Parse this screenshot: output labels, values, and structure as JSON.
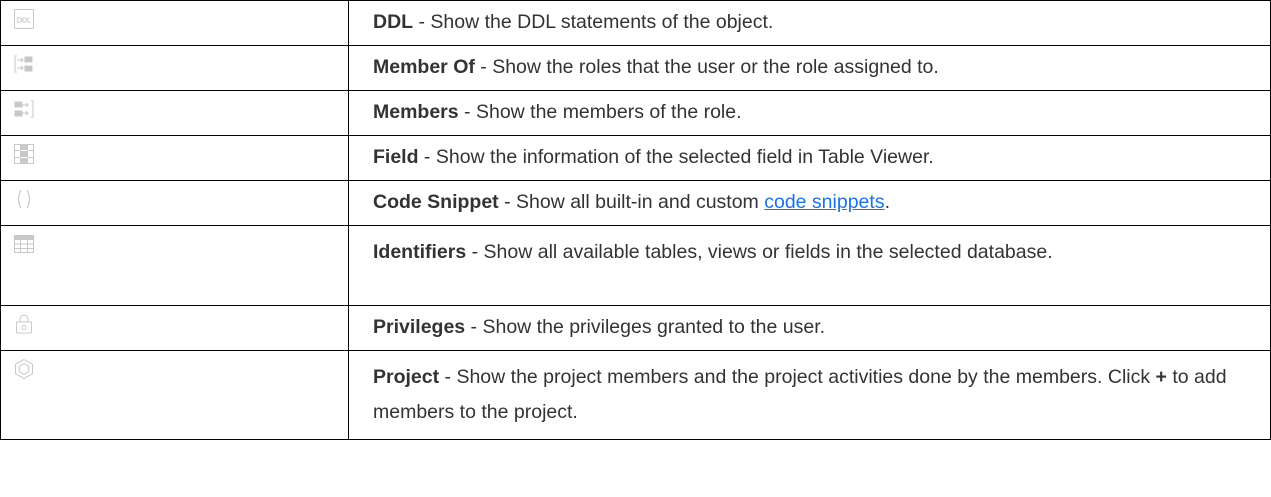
{
  "rows": [
    {
      "icon": "ddl-icon",
      "name": "DDL",
      "sep": " - ",
      "desc": "Show the DDL statements of the object."
    },
    {
      "icon": "member-of-icon",
      "name": "Member Of",
      "sep": " - ",
      "desc": "Show the roles that the user or the role assigned to."
    },
    {
      "icon": "members-icon",
      "name": "Members",
      "sep": " - ",
      "desc": "Show the members of the role."
    },
    {
      "icon": "field-icon",
      "name": "Field",
      "sep": " - ",
      "desc": "Show the information of the selected field in Table Viewer."
    },
    {
      "icon": "code-snippet-icon",
      "name": "Code Snippet",
      "sep": " - ",
      "desc": "Show all built-in and custom ",
      "link": "code snippets",
      "after": "."
    },
    {
      "icon": "identifiers-icon",
      "name": "Identifiers",
      "sep": " - ",
      "desc": "Show all available tables, views or fields in the selected database."
    },
    {
      "icon": "privileges-icon",
      "name": "Privileges",
      "sep": " - ",
      "desc": "Show the privileges granted to the user."
    },
    {
      "icon": "project-icon",
      "name": "Project",
      "sep": " - ",
      "desc": "Show the project members and the project activities done by the members. Click ",
      "bold2": "+",
      "after": " to add members to the project."
    }
  ],
  "icon_color": "#c8c8c8",
  "link_color": "#1a73e8",
  "ddl_icon_text": "DDL"
}
